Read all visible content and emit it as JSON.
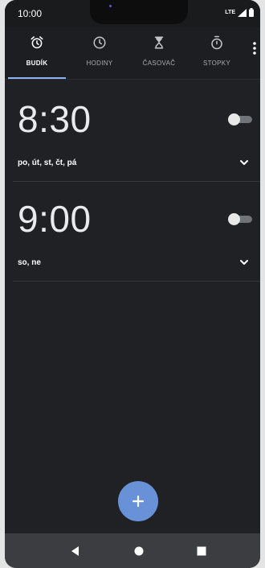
{
  "status_bar": {
    "time": "10:00",
    "network_label": "LTE",
    "icons": [
      "signal-icon",
      "battery-icon"
    ]
  },
  "tabs": [
    {
      "label": "BUDÍK",
      "icon": "alarm-clock-icon",
      "active": true
    },
    {
      "label": "HODINY",
      "icon": "clock-icon",
      "active": false
    },
    {
      "label": "ČASOVAČ",
      "icon": "hourglass-icon",
      "active": false
    },
    {
      "label": "STOPKY",
      "icon": "stopwatch-icon",
      "active": false
    }
  ],
  "alarms": [
    {
      "time": "8:30",
      "days": "po, út, st, čt, pá",
      "enabled": false
    },
    {
      "time": "9:00",
      "days": "so, ne",
      "enabled": false
    }
  ],
  "fab": {
    "icon": "plus-icon"
  },
  "nav_bar": {
    "icons": [
      "back-icon",
      "home-icon",
      "recents-icon"
    ]
  },
  "colors": {
    "background": "#202124",
    "accent": "#8ab4f8",
    "fab": "#6891d8",
    "navbar": "#3c3d40"
  }
}
